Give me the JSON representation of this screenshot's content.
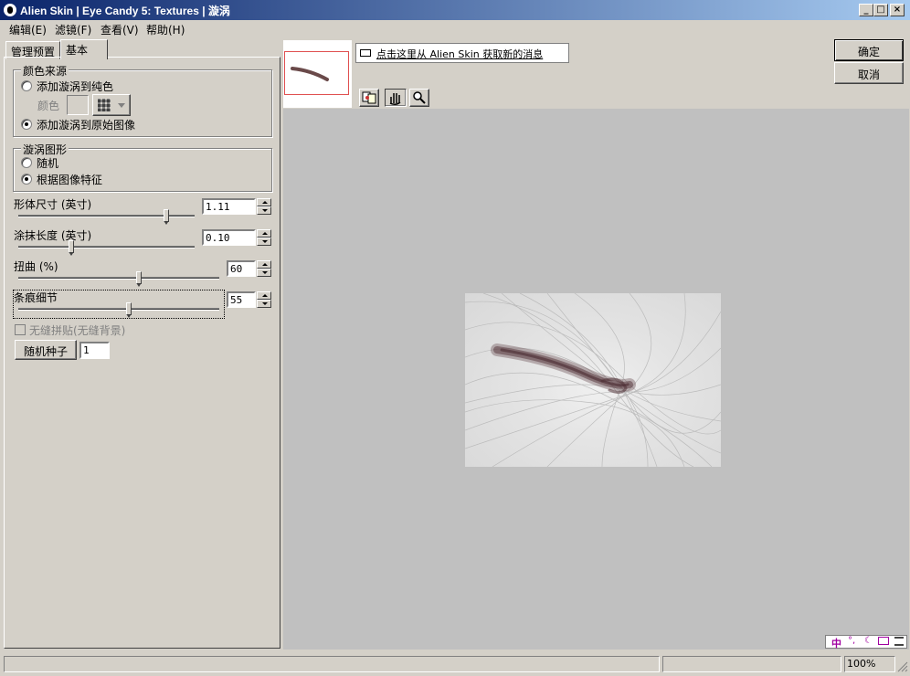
{
  "window": {
    "title": "Alien Skin | Eye Candy 5: Textures | 漩涡"
  },
  "menu": [
    "编辑(E)",
    "滤镜(F)",
    "查看(V)",
    "帮助(H)"
  ],
  "tabs": [
    "管理预置",
    "基本"
  ],
  "color_source": {
    "title": "颜色来源",
    "option_solid": "添加漩涡到纯色",
    "color_label": "颜色",
    "option_original": "添加漩涡到原始图像"
  },
  "swirl_shape": {
    "title": "漩涡图形",
    "option_random": "随机",
    "option_features": "根据图像特征"
  },
  "params": {
    "shape_size": {
      "label": "形体尺寸 (英寸)",
      "value": "1.11",
      "fraction": 0.84
    },
    "smear_length": {
      "label": "涂抹长度 (英寸)",
      "value": "0.10",
      "fraction": 0.3
    },
    "twist": {
      "label": "扭曲 (%)",
      "value": "60",
      "fraction": 0.6
    },
    "streak_detail": {
      "label": "条痕细节",
      "value": "55",
      "fraction": 0.55
    }
  },
  "seamless_tile": "无缝拼贴(无缝背景)",
  "random_seed": {
    "label": "随机种子",
    "value": "1"
  },
  "news_link": "点击这里从 Alien Skin 获取新的消息",
  "buttons": {
    "ok": "确定",
    "cancel": "取消"
  },
  "status": {
    "zoom": "100%"
  }
}
